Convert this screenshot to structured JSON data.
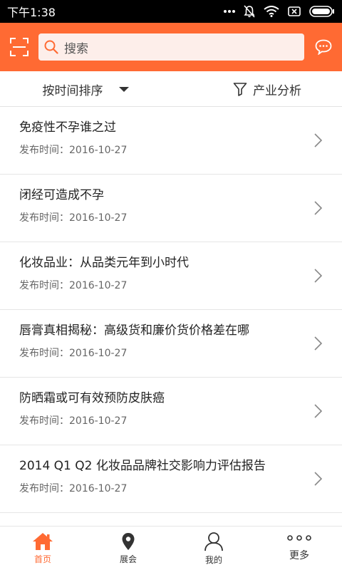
{
  "status_bar": {
    "time": "下午1:38"
  },
  "header": {
    "search_placeholder": "搜索",
    "accent_color": "#ff6a33"
  },
  "filter_bar": {
    "sort_label": "按时间排序",
    "analysis_label": "产业分析"
  },
  "articles": [
    {
      "title": "免疫性不孕谁之过",
      "date_label": "发布时间：",
      "date": "2016-10-27"
    },
    {
      "title": "闭经可造成不孕",
      "date_label": "发布时间：",
      "date": "2016-10-27"
    },
    {
      "title": "化妆品业：从品类元年到小时代",
      "date_label": "发布时间：",
      "date": "2016-10-27"
    },
    {
      "title": "唇膏真相揭秘：高级货和廉价货价格差在哪",
      "date_label": "发布时间：",
      "date": "2016-10-27"
    },
    {
      "title": "防晒霜或可有效预防皮肤癌",
      "date_label": "发布时间：",
      "date": "2016-10-27"
    },
    {
      "title": "2014 Q1 Q2 化妆品品牌社交影响力评估报告",
      "date_label": "发布时间：",
      "date": "2016-10-27"
    }
  ],
  "bottom_nav": [
    {
      "label": "首页",
      "icon": "home-icon",
      "active": true
    },
    {
      "label": "展会",
      "icon": "location-pin-icon",
      "active": false
    },
    {
      "label": "我的",
      "icon": "person-icon",
      "active": false
    },
    {
      "label": "更多",
      "icon": "more-dots-icon",
      "active": false
    }
  ]
}
